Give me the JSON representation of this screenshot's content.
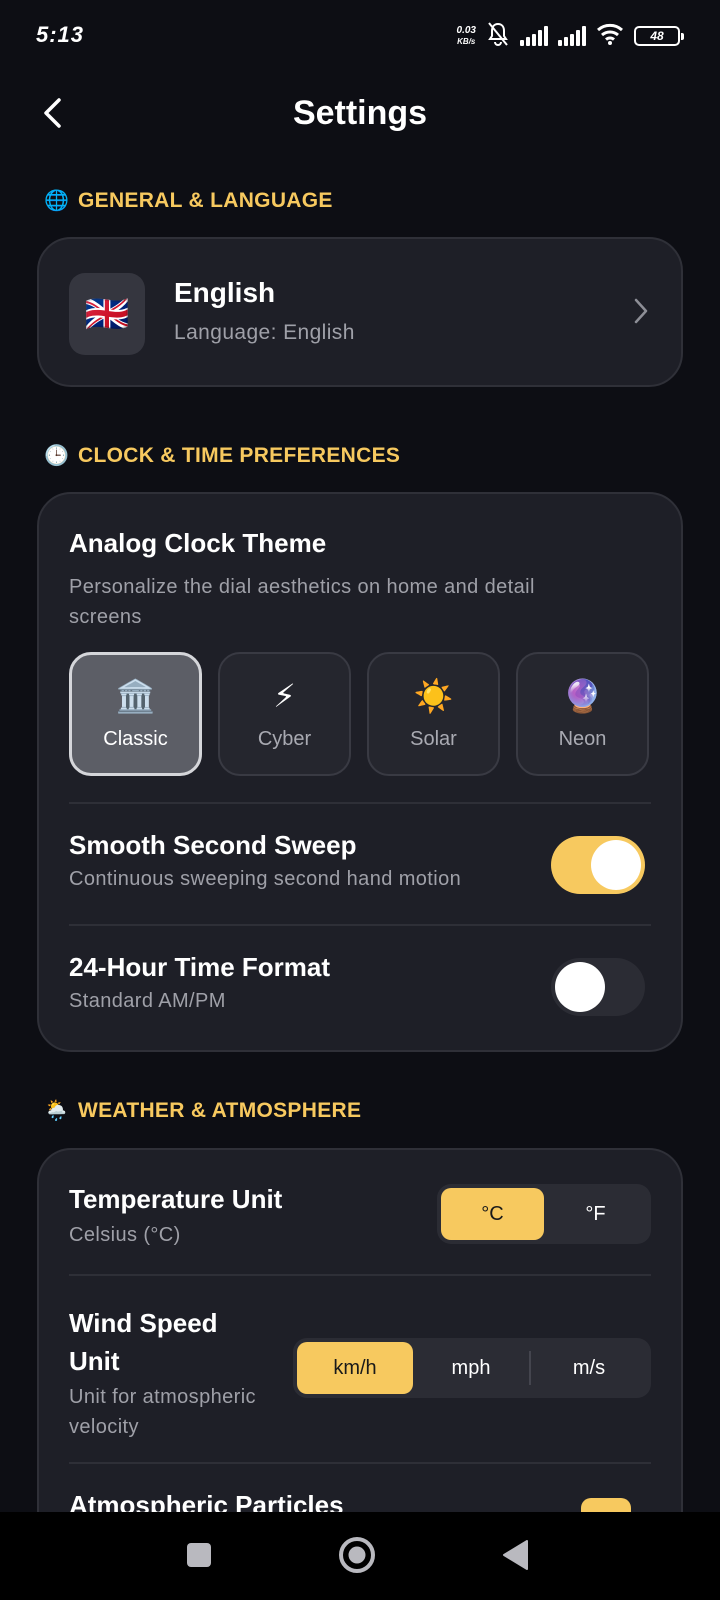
{
  "status": {
    "time": "5:13",
    "net_speed_value": "0.03",
    "net_speed_unit": "KB/s",
    "battery": "48"
  },
  "header": {
    "title": "Settings"
  },
  "sections": {
    "general": {
      "emoji": "🌐",
      "label": "GENERAL & LANGUAGE"
    },
    "clock": {
      "emoji": "🕒",
      "label": "CLOCK & TIME PREFERENCES"
    },
    "weather": {
      "emoji": "🌦️",
      "label": "WEATHER & ATMOSPHERE"
    }
  },
  "language": {
    "flag": "🇬🇧",
    "title": "English",
    "subtitle": "Language: English"
  },
  "clock": {
    "theme_title": "Analog Clock Theme",
    "theme_subtitle_line1": "Personalize the dial aesthetics on home and detail",
    "theme_subtitle_line2": "screens",
    "themes": [
      {
        "icon": "🏛️",
        "label": "Classic",
        "active": true
      },
      {
        "icon": "⚡",
        "label": "Cyber",
        "active": false
      },
      {
        "icon": "☀️",
        "label": "Solar",
        "active": false
      },
      {
        "icon": "🔮",
        "label": "Neon",
        "active": false
      }
    ],
    "sweep_title": "Smooth Second Sweep",
    "sweep_subtitle": "Continuous sweeping second hand motion",
    "sweep_enabled": true,
    "format_title": "24-Hour Time Format",
    "format_subtitle": "Standard AM/PM",
    "format_enabled": false
  },
  "weather": {
    "temp_title": "Temperature Unit",
    "temp_subtitle": "Celsius (°C)",
    "temp_options": [
      "°C",
      "°F"
    ],
    "temp_selected": "°C",
    "wind_title_line1": "Wind Speed",
    "wind_title_line2": "Unit",
    "wind_subtitle_line1": "Unit for atmospheric",
    "wind_subtitle_line2": "velocity",
    "wind_options": [
      "km/h",
      "mph",
      "m/s"
    ],
    "wind_selected": "km/h",
    "particles_title": "Atmospheric Particles"
  },
  "colors": {
    "accent": "#f7c95f",
    "background": "#0d0e14",
    "card": "#1e1f27",
    "muted_text": "#9fa0a8"
  }
}
